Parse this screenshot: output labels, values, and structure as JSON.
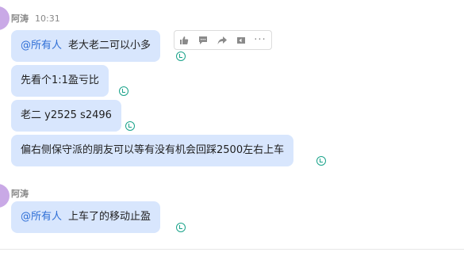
{
  "messages_group_1": {
    "sender": "阿涛",
    "time": "10:31",
    "msg1": {
      "mention": "@所有人",
      "text": "老大老二可以小多"
    },
    "msg2": {
      "text": "先看个1:1盈亏比"
    },
    "msg3": {
      "text": "老二 y2525 s2496"
    },
    "msg4": {
      "text": "偏右侧保守派的朋友可以等有没有机会回踩2500左右上车"
    }
  },
  "messages_group_2": {
    "sender": "阿涛",
    "msg1": {
      "mention": "@所有人",
      "text": "上车了的移动止盈"
    }
  },
  "toolbar": {
    "icons": [
      "thumbs-up-icon",
      "comment-icon",
      "forward-icon",
      "pin-icon",
      "more-icon"
    ],
    "more_label": "···"
  },
  "colors": {
    "bubble": "#d8e6fd",
    "mention": "#2f6fd6",
    "read_receipt": "#1aa38a",
    "avatar": "#c9a9e6"
  }
}
